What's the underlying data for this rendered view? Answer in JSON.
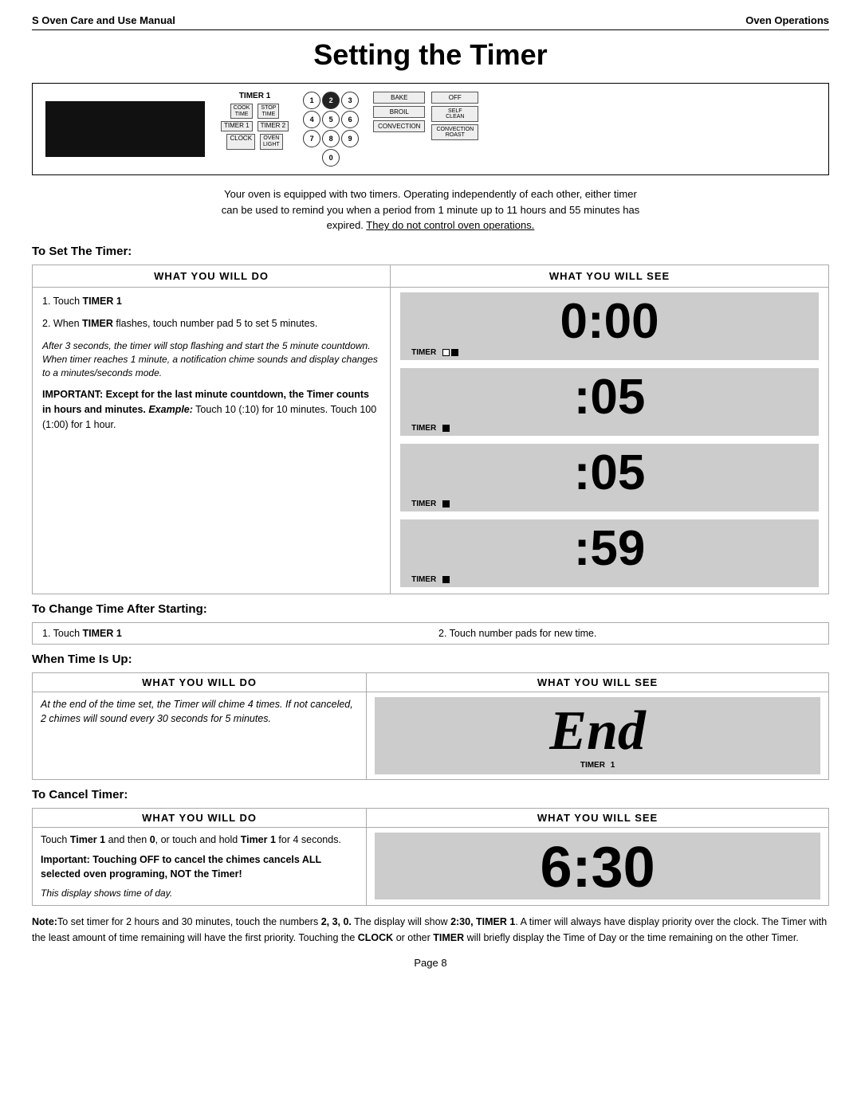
{
  "header": {
    "left": "S Oven Care and Use Manual",
    "right": "Oven Operations"
  },
  "title": "Setting the Timer",
  "panel": {
    "timer_label": "TIMER 1",
    "cook_time": "COOK TIME",
    "stop_time": "STOP TIME",
    "timer1": "TIMER 1",
    "timer2": "TIMER 2",
    "clock": "CLOCK",
    "oven_light": "OVEN LIGHT",
    "numpad": [
      "1",
      "2",
      "3",
      "4",
      "5",
      "6",
      "7",
      "8",
      "9",
      "0"
    ],
    "highlighted_btn": "2",
    "bake": "BAKE",
    "off": "OFF",
    "broil": "BROIL",
    "self_clean": "SELF CLEAN",
    "convection": "CONVECTION",
    "convection_roast": "CONVECTION ROAST"
  },
  "intro": {
    "line1": "Your oven is equipped with two timers.  Operating independently of each other, either timer",
    "line2": "can be used to remind you when a period from 1 minute up to 11 hours and 55 minutes has",
    "line3_plain": "expired. ",
    "line3_underline": "They do not control oven operations."
  },
  "set_timer": {
    "heading": "To Set The Timer:",
    "col_do_header": "WHAT  YOU  WILL DO",
    "col_see_header": "WHAT  YOU  WILL SEE",
    "steps": [
      {
        "step": "1.  Touch ",
        "bold": "TIMER 1"
      },
      {
        "step_plain": "2.  When ",
        "step_bold": "TIMER",
        "step_plain2": " flashes, touch number pad 5 to set 5 minutes."
      }
    ],
    "italic_block": "After 3 seconds, the timer will stop flashing and start the 5 minute countdown.  When timer reaches 1 minute, a notification chime sounds and display changes to a minutes/seconds mode.",
    "important_bold": "IMPORTANT: Except for the last minute countdown, the Timer counts in hours and minutes. ",
    "important_italic_prefix": "Example:",
    "important_plain": " Touch 10 (:10) for 10 minutes. Touch 100 (1:00) for 1 hour.",
    "displays": [
      {
        "digits": "0:00",
        "timer_text": "TIMER",
        "squares": [
          false,
          true
        ]
      },
      {
        "digits": ":05",
        "timer_text": "TIMER",
        "squares": [
          false,
          true
        ]
      },
      {
        "digits": ":05",
        "timer_text": "TIMER",
        "squares": [
          false,
          true
        ]
      },
      {
        "digits": ":59",
        "timer_text": "TIMER",
        "squares": [
          false,
          true
        ]
      }
    ]
  },
  "change_time": {
    "heading": "To Change Time After Starting:",
    "step1_plain": "1.  Touch ",
    "step1_bold": "TIMER 1",
    "step2": "2.  Touch number pads for new time."
  },
  "when_time_up": {
    "heading": "When Time Is Up:",
    "col_do_header": "WHAT  YOU  WILL DO",
    "col_see_header": "WHAT  YOU  WILL SEE",
    "italic_text": "At the end of the time set, the Timer will  chime 4 times.  If not canceled, 2 chimes will sound every 30 seconds for 5 minutes.",
    "display_text": "End",
    "timer_label": "TIMER",
    "timer_number": "1"
  },
  "cancel_timer": {
    "heading": "To Cancel Timer:",
    "col_do_header": "WHAT  YOU  WILL DO",
    "col_see_header": "WHAT  YOU  WILL SEE",
    "do_text_plain1": "Touch ",
    "do_text_bold1": "Timer 1",
    "do_text_plain2": " and then ",
    "do_text_bold2": "0",
    "do_text_plain3": ", or touch and hold ",
    "do_text_bold3": "Timer 1",
    "do_text_plain4": " for 4 seconds.",
    "important_line1_bold": "Important: ",
    "important_line1_plain": " Touching OFF to cancel the chimes cancels  ALL selected oven programing, NOT the Timer!",
    "italic_note": "This display shows time of day.",
    "display_630": "6:30"
  },
  "bottom_note": {
    "note_bold": "Note:",
    "note_plain": "To set timer for 2 hours and 30 minutes, touch the numbers ",
    "note_bold2": "2, 3, 0.",
    "note_plain2": "  The display will show ",
    "note_bold3": "2:30, TIMER 1",
    "note_plain3": ".  A timer will always have display priority over the clock.  The Timer with the least amount of time remaining will have the first priority.  Touching the ",
    "note_bold4": "CLOCK",
    "note_plain4": " or other ",
    "note_bold5": "TIMER",
    "note_plain5": " will briefly display the Time of Day or the time remaining on the other Timer."
  },
  "page_number": "Page 8"
}
